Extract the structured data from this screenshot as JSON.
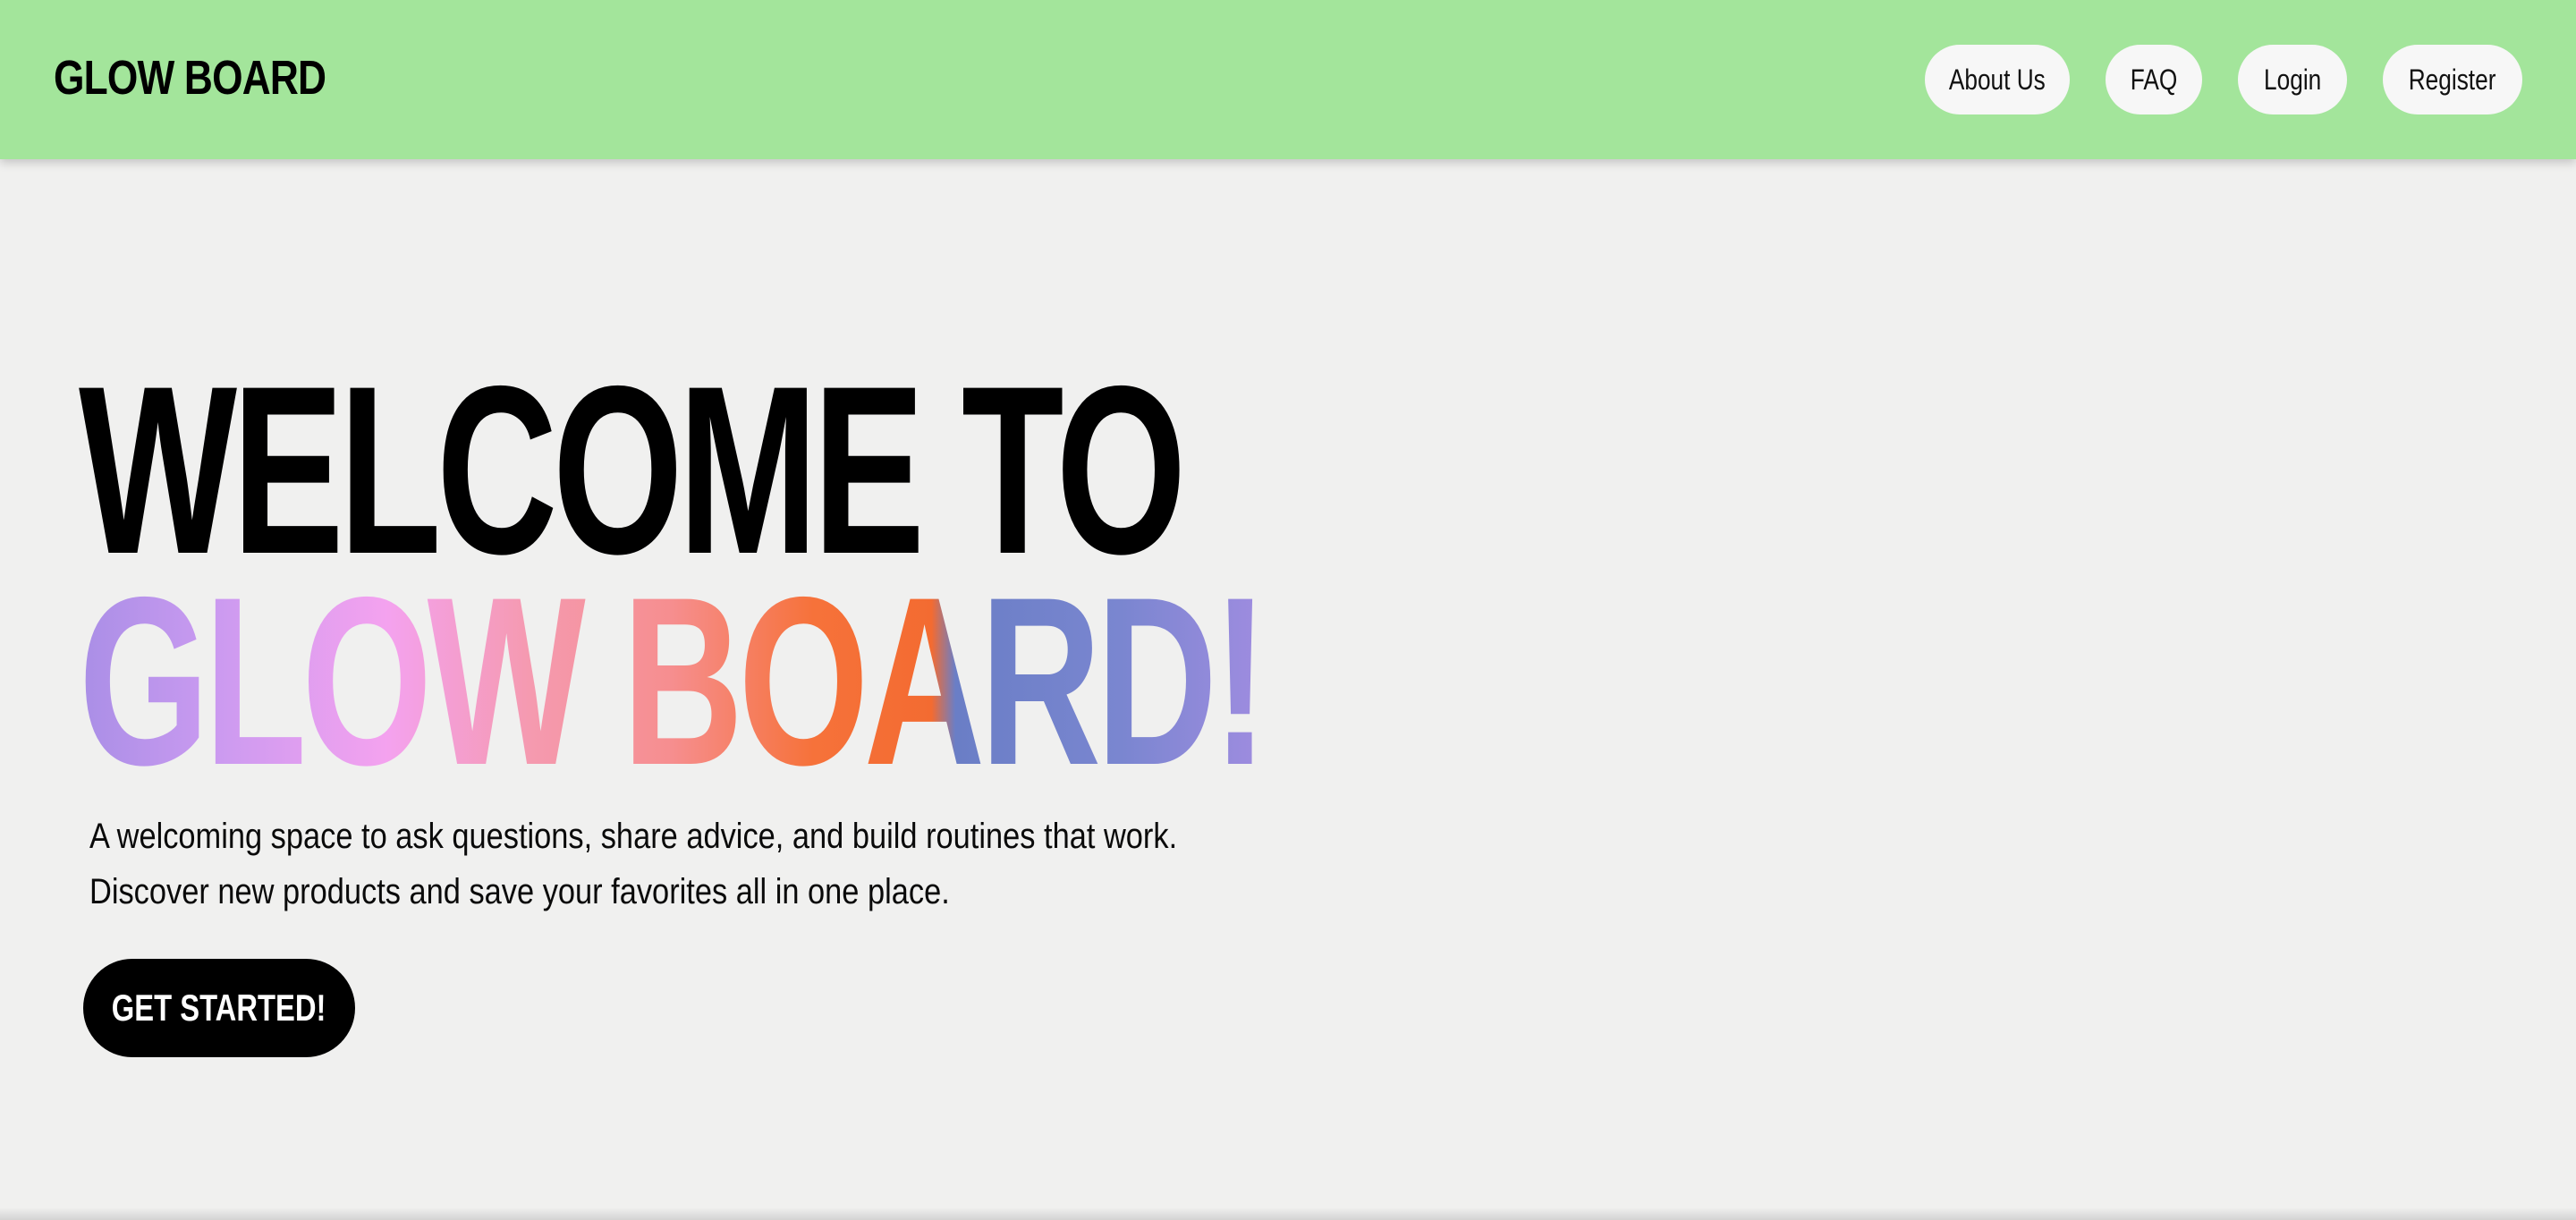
{
  "header": {
    "brand": "GLOW BOARD",
    "nav": [
      {
        "label": "About Us"
      },
      {
        "label": "FAQ"
      },
      {
        "label": "Login"
      },
      {
        "label": "Register"
      }
    ]
  },
  "hero": {
    "title_line1": "WELCOME TO",
    "title_line2": "GLOW BOARD!",
    "tagline_line1": "A welcoming space to ask questions, share advice, and build routines that work.",
    "tagline_line2": "Discover new products and save your favorites all in one place.",
    "cta_label": "GET STARTED!"
  },
  "colors": {
    "header_bg": "#a3e59b",
    "page_bg": "#f0f0ef",
    "button_bg": "#f7f7f7",
    "cta_bg": "#000000",
    "gradient": [
      "#a98ee6",
      "#f4a2ef",
      "#f68e8f",
      "#f36b31",
      "#6a7ec6",
      "#9f8ce0"
    ]
  }
}
